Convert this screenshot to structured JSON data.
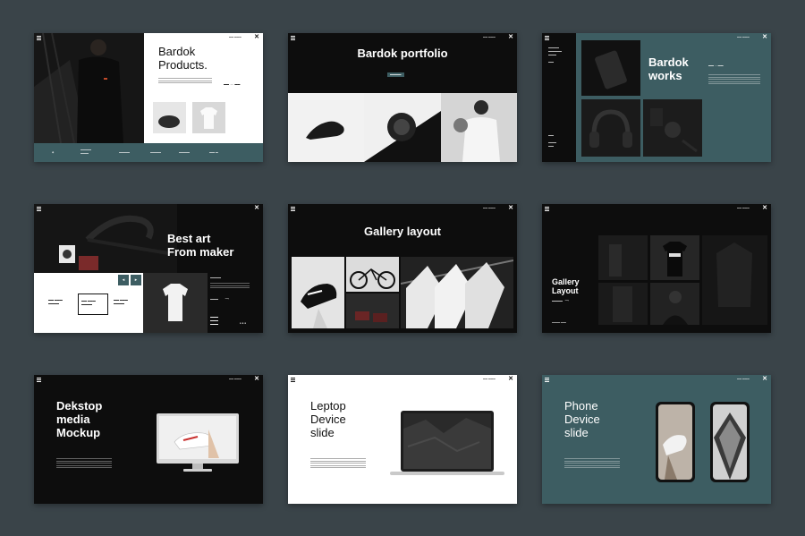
{
  "slides": {
    "s1": {
      "title_line1": "Bardok",
      "title_line2": "Products.",
      "close": "✕",
      "menu": "menu-icon"
    },
    "s2": {
      "title": "Bardok portfolio",
      "close": "✕"
    },
    "s3": {
      "title_line1": "Bardok",
      "title_line2": "works",
      "close": "✕"
    },
    "s4": {
      "title_line1": "Best art",
      "title_line2": "From maker",
      "close": "✕"
    },
    "s5": {
      "title": "Gallery layout",
      "close": "✕"
    },
    "s6": {
      "title_line1": "Gallery",
      "title_line2": "Layout",
      "close": "✕"
    },
    "s7": {
      "title_line1": "Dekstop",
      "title_line2": "media",
      "title_line3": "Mockup",
      "close": "✕"
    },
    "s8": {
      "title_line1": "Leptop",
      "title_line2": "Device",
      "title_line3": "slide",
      "close": "✕"
    },
    "s9": {
      "title_line1": "Phone",
      "title_line2": "Device",
      "title_line3": "slide",
      "close": "✕"
    }
  },
  "colors": {
    "background": "#3a4449",
    "dark": "#0d0d0d",
    "teal": "#3d5d62",
    "white": "#ffffff"
  }
}
